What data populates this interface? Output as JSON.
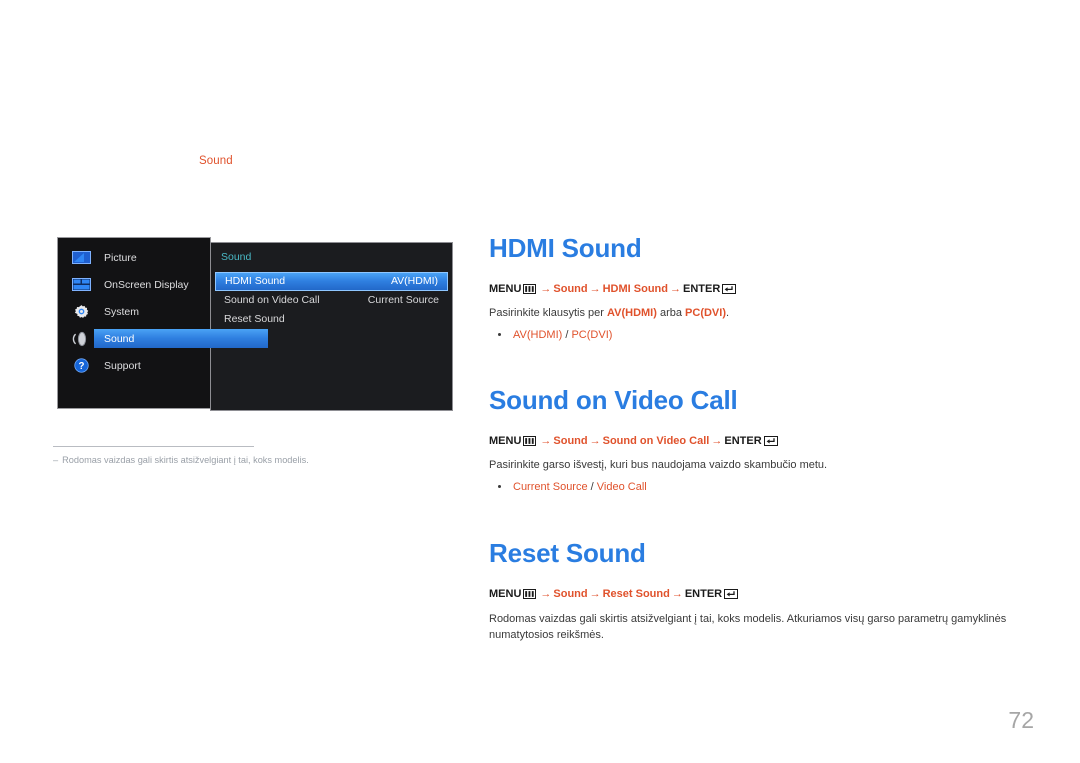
{
  "breadcrumb": {
    "label": "Sound"
  },
  "osd": {
    "sidebar": [
      {
        "label": "Picture",
        "icon": "picture-icon",
        "active": false
      },
      {
        "label": "OnScreen Display",
        "icon": "onscreen-display-icon",
        "active": false
      },
      {
        "label": "System",
        "icon": "gear-icon",
        "active": false
      },
      {
        "label": "Sound",
        "icon": "sound-icon",
        "active": true
      },
      {
        "label": "Support",
        "icon": "question-mark-icon",
        "active": false
      }
    ],
    "panel_title": "Sound",
    "rows": [
      {
        "label": "HDMI Sound",
        "value": "AV(HDMI)",
        "selected": true
      },
      {
        "label": "Sound on Video Call",
        "value": "Current Source",
        "selected": false
      },
      {
        "label": "Reset Sound",
        "value": "",
        "selected": false
      }
    ],
    "colors": {
      "highlight": "#2f7fe0",
      "panel_title": "#49b8c4",
      "background": "#121214"
    }
  },
  "footnote": {
    "dash": "‒",
    "text": "Rodomas vaizdas gali skirtis atsižvelgiant į tai, koks modelis."
  },
  "sections": [
    {
      "heading": "HDMI Sound",
      "path": {
        "menu": "MENU",
        "arrow": "→",
        "p1": "Sound",
        "p2": "HDMI Sound",
        "enter": "ENTER"
      },
      "desc_pre": "Pasirinkite klausytis per ",
      "desc_a": "AV(HDMI)",
      "desc_mid": " arba ",
      "desc_b": "PC(DVI)",
      "desc_post": ".",
      "bullet_a": "AV(HDMI)",
      "bullet_sep": " / ",
      "bullet_b": "PC(DVI)"
    },
    {
      "heading": "Sound on Video Call",
      "path": {
        "menu": "MENU",
        "arrow": "→",
        "p1": "Sound",
        "p2": "Sound on Video Call",
        "enter": "ENTER"
      },
      "desc_pre": "Pasirinkite garso išvestį, kuri bus naudojama vaizdo skambučio metu.",
      "desc_a": "",
      "desc_mid": "",
      "desc_b": "",
      "desc_post": "",
      "bullet_a": "Current Source",
      "bullet_sep": " / ",
      "bullet_b": "Video Call"
    },
    {
      "heading": "Reset Sound",
      "path": {
        "menu": "MENU",
        "arrow": "→",
        "p1": "Sound",
        "p2": "Reset Sound",
        "enter": "ENTER"
      },
      "body": "Rodomas vaizdas gali skirtis atsižvelgiant į tai, koks modelis. Atkuriamos visų garso parametrų gamyklinės numatytosios reikšmės."
    }
  ],
  "page_number": "72",
  "colors": {
    "heading": "#2a7de1",
    "accent": "#e0522c",
    "body": "#3a3a3a",
    "page_number": "#a6a6a6"
  }
}
